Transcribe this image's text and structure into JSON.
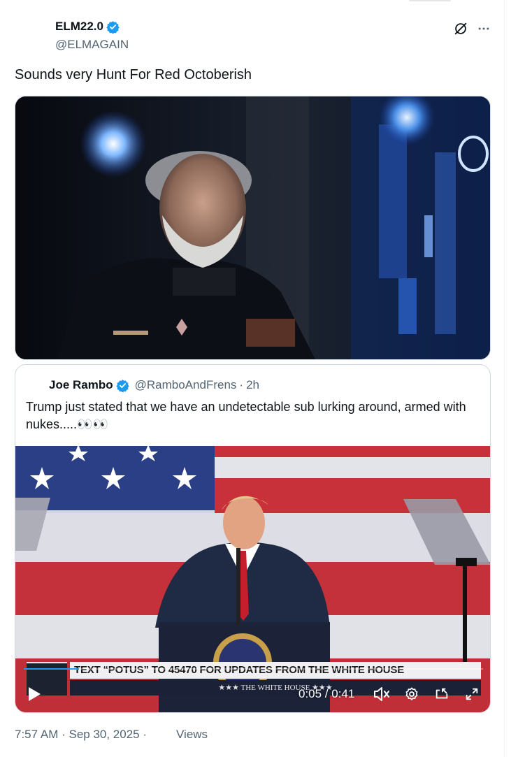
{
  "post": {
    "display_name": "ELM22.0",
    "handle": "@ELMAGAIN",
    "text": "Sounds very Hunt For Red Octoberish",
    "timestamp": "7:57 AM · Sep 30, 2025 ·",
    "views_label": "Views"
  },
  "icons": {
    "verified": "verified-badge-icon",
    "grok": "grok-icon",
    "more": "more-icon"
  },
  "media": {
    "image_alt_name": "movie-still"
  },
  "quote": {
    "display_name": "Joe Rambo",
    "handle": "@RamboAndFrens",
    "separator": "·",
    "time": "2h",
    "text": "Trump just stated that we have an undetectable sub lurking around, armed with nukes.....👀👀"
  },
  "video": {
    "banner_text": "TEXT “POTUS” TO 45470 FOR UPDATES FROM THE WHITE HOUSE",
    "banner_sub": "★★★  THE WHITE HOUSE  ★★★",
    "time_display": "0:05 / 0:41",
    "progress": 0.12
  },
  "colors": {
    "accent": "#1d9bf0",
    "secondary_text": "#536471",
    "primary_text": "#0f1419"
  }
}
